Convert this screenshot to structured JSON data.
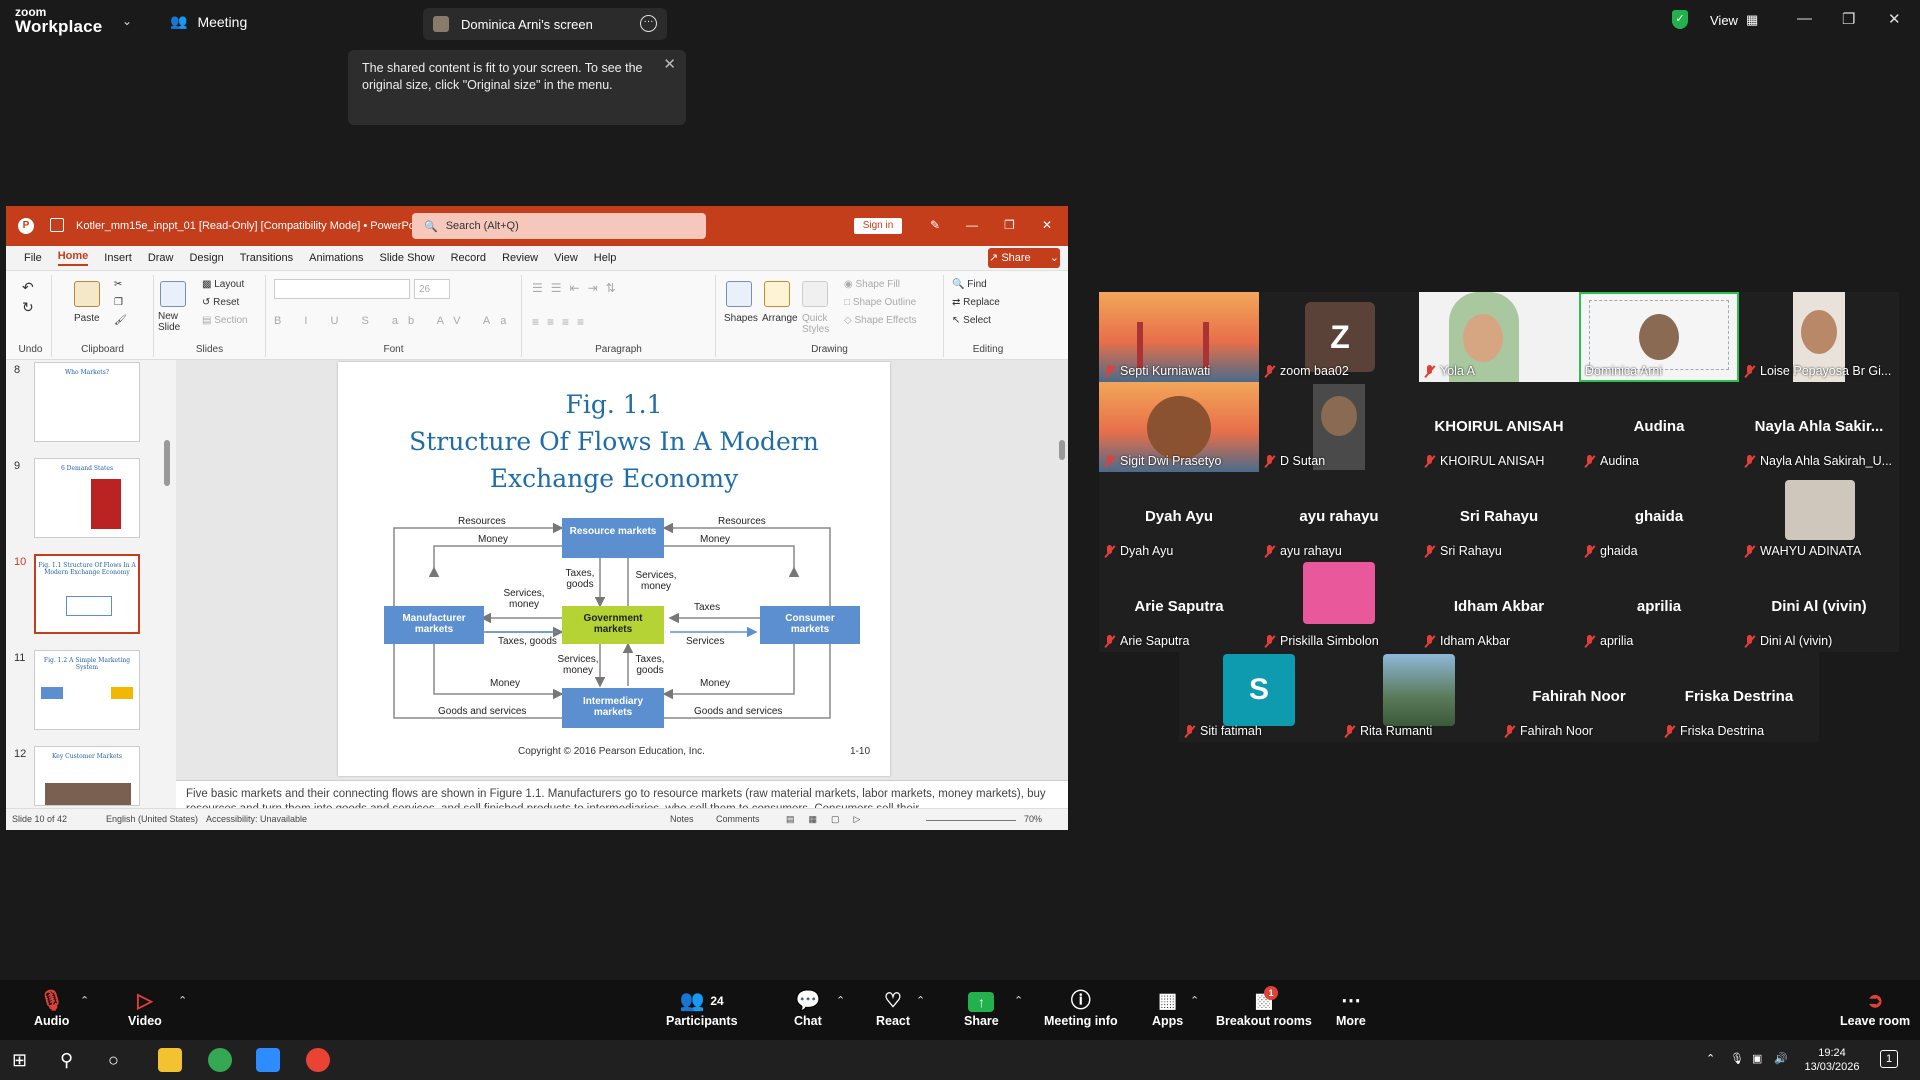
{
  "topbar": {
    "brand_small": "zoom",
    "brand_big": "Workplace",
    "meeting_label": "Meeting",
    "screen_tab": "Dominica Arni's screen",
    "view_label": "View"
  },
  "tooltip": {
    "text": "The shared content is fit to your screen. To see the original size, click \"Original size\" in the menu."
  },
  "ppt": {
    "filename": "Kotler_mm15e_inppt_01 [Read-Only] [Compatibility Mode]  •  PowerPoint",
    "search_placeholder": "Search (Alt+Q)",
    "signin": "Sign in",
    "share": "Share",
    "menu": [
      "File",
      "Home",
      "Insert",
      "Draw",
      "Design",
      "Transitions",
      "Animations",
      "Slide Show",
      "Record",
      "Review",
      "View",
      "Help"
    ],
    "ribbon": {
      "undo": "Undo",
      "clipboard": "Clipboard",
      "paste": "Paste",
      "new_slide": "New Slide",
      "layout": "Layout",
      "reset": "Reset",
      "section": "Section",
      "slides": "Slides",
      "font": "Font",
      "font_size": "26",
      "paragraph": "Paragraph",
      "shapes": "Shapes",
      "arrange": "Arrange",
      "quick_styles": "Quick Styles",
      "shape_fill": "Shape Fill",
      "shape_outline": "Shape Outline",
      "shape_effects": "Shape Effects",
      "drawing": "Drawing",
      "find": "Find",
      "replace": "Replace",
      "select": "Select",
      "editing": "Editing"
    },
    "thumbs": [
      {
        "num": "8",
        "title": "Who Markets?"
      },
      {
        "num": "9",
        "title": "6 Demand States"
      },
      {
        "num": "10",
        "title": "Fig. 1.1 Structure Of Flows In A Modern Exchange Economy"
      },
      {
        "num": "11",
        "title": "Fig. 1.2 A Simple Marketing System"
      },
      {
        "num": "12",
        "title": "Key Customer Markets"
      }
    ],
    "slide": {
      "title1": "Fig. 1.1",
      "title2": "Structure Of Flows In A Modern",
      "title3": "Exchange Economy",
      "footer": "Copyright © 2016 Pearson Education, Inc.",
      "page": "1-10",
      "diagram": {
        "resource": "Resource markets",
        "government": "Government markets",
        "manufacturer": "Manufacturer markets",
        "consumer": "Consumer markets",
        "intermediary": "Intermediary markets",
        "resources_l": "Resources",
        "resources_r": "Resources",
        "money_l": "Money",
        "money_r": "Money",
        "taxes_goods_top": "Taxes, goods",
        "services_money_top": "Services, money",
        "services_money_left": "Services, money",
        "taxes": "Taxes",
        "taxes_goods_left": "Taxes, goods",
        "services": "Services",
        "services_money_bottom": "Services, money",
        "taxes_goods_bottom": "Taxes, goods",
        "money_bl": "Money",
        "money_br": "Money",
        "goods_services_l": "Goods and services",
        "goods_services_r": "Goods and services"
      }
    },
    "notes": "Five basic markets and their connecting flows are shown in Figure 1.1. Manufacturers go to resource markets (raw material markets, labor markets, money markets), buy resources and turn them into goods and services, and sell finished products to intermediaries, who sell them to consumers. Consumers sell their",
    "status": {
      "slide": "Slide 10 of 42",
      "lang": "English (United States)",
      "access": "Accessibility: Unavailable",
      "notes": "Notes",
      "comments": "Comments",
      "zoom": "70%"
    }
  },
  "participants": [
    {
      "big": "",
      "label": "Septi Kurniawati"
    },
    {
      "big": "Z",
      "label": "zoom baa02"
    },
    {
      "big": "",
      "label": "Yola A"
    },
    {
      "big": "",
      "label": "Dominica Arni"
    },
    {
      "big": "",
      "label": "Loise Pepayosa Br Gi..."
    },
    {
      "big": "",
      "label": "Sigit Dwi Prasetyo"
    },
    {
      "big": "",
      "label": "D  Sutan"
    },
    {
      "big": "KHOIRUL ANISAH",
      "label": "KHOIRUL ANISAH"
    },
    {
      "big": "Audina",
      "label": "Audina"
    },
    {
      "big": "Nayla Ahla Sakir...",
      "label": "Nayla Ahla Sakirah_U..."
    },
    {
      "big": "Dyah Ayu",
      "label": "Dyah Ayu"
    },
    {
      "big": "ayu rahayu",
      "label": "ayu rahayu"
    },
    {
      "big": "Sri Rahayu",
      "label": "Sri Rahayu"
    },
    {
      "big": "ghaida",
      "label": "ghaida"
    },
    {
      "big": "",
      "label": "WAHYU ADINATA"
    },
    {
      "big": "Arie Saputra",
      "label": "Arie Saputra"
    },
    {
      "big": "",
      "label": "Priskilla Simbolon"
    },
    {
      "big": "Idham Akbar",
      "label": "Idham Akbar"
    },
    {
      "big": "aprilia",
      "label": "aprilia"
    },
    {
      "big": "Dini Al (vivin)",
      "label": "Dini Al (vivin)"
    },
    {
      "big": "S",
      "label": "Siti fatimah"
    },
    {
      "big": "",
      "label": "Rita Rumanti"
    },
    {
      "big": "Fahirah Noor",
      "label": "Fahirah Noor"
    },
    {
      "big": "Friska Destrina",
      "label": "Friska Destrina"
    }
  ],
  "toolbar": {
    "audio": "Audio",
    "video": "Video",
    "participants": "Participants",
    "participants_count": "24",
    "chat": "Chat",
    "react": "React",
    "share": "Share",
    "meeting_info": "Meeting info",
    "apps": "Apps",
    "breakout": "Breakout rooms",
    "breakout_badge": "1",
    "more": "More",
    "leave": "Leave room"
  },
  "taskbar": {
    "time": "19:24",
    "date": "13/03/2026",
    "notif": "1"
  },
  "colors": {
    "ppt_accent": "#c43e1c",
    "box_blue": "#5b8fd0",
    "box_green": "#b5d334",
    "active_speaker": "#2fbf4f",
    "mute_red": "#e0403a"
  }
}
